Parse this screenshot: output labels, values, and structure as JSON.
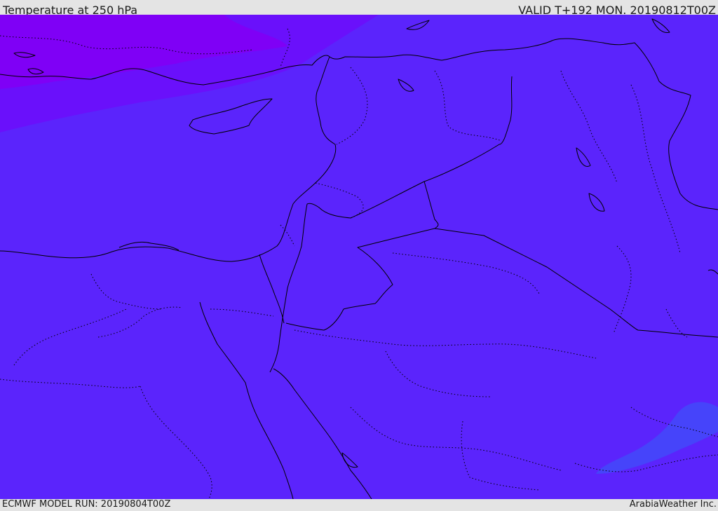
{
  "header": {
    "title": "Temperature at 250 hPa",
    "valid": "VALID T+192 MON. 20190812T00Z"
  },
  "footer": {
    "model_run": "ECMWF MODEL RUN: 20190804T00Z",
    "credit": "ArabiaWeather Inc."
  },
  "colors": {
    "band_very_cold": "#7f00f6",
    "band_cold": "#6a10fb",
    "band_main": "#5b24fc",
    "band_warm_patch": "#4644fa",
    "border_line": "#000000"
  }
}
